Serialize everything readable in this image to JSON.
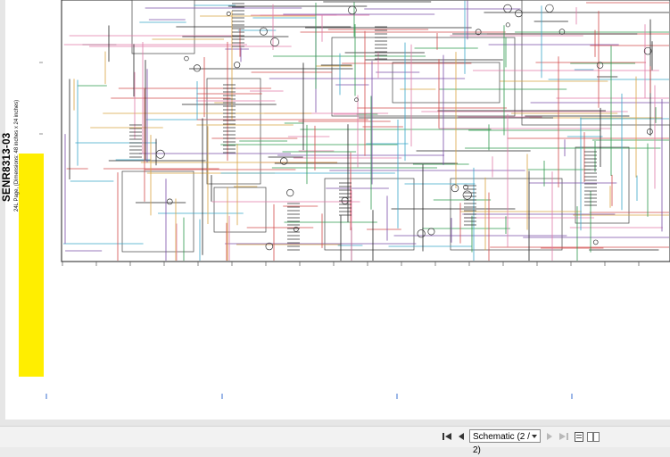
{
  "sheet": {
    "doc_id": "SENR8313-03",
    "page_note": "24L Page, (Dimensions: 48 inches x 24 inches)"
  },
  "toolbar": {
    "page_select_value": "Schematic (2 / 2)",
    "icons": [
      "first-page-icon",
      "previous-page-icon",
      "next-page-icon",
      "last-page-icon",
      "single-page-view-icon",
      "two-page-view-icon"
    ]
  },
  "colors": {
    "title_block": "#ffee00",
    "wires": [
      "#222222",
      "#d24b4b",
      "#3aa6c9",
      "#d9a441",
      "#7a4fa8",
      "#2e9a4e",
      "#e07aa8"
    ]
  }
}
